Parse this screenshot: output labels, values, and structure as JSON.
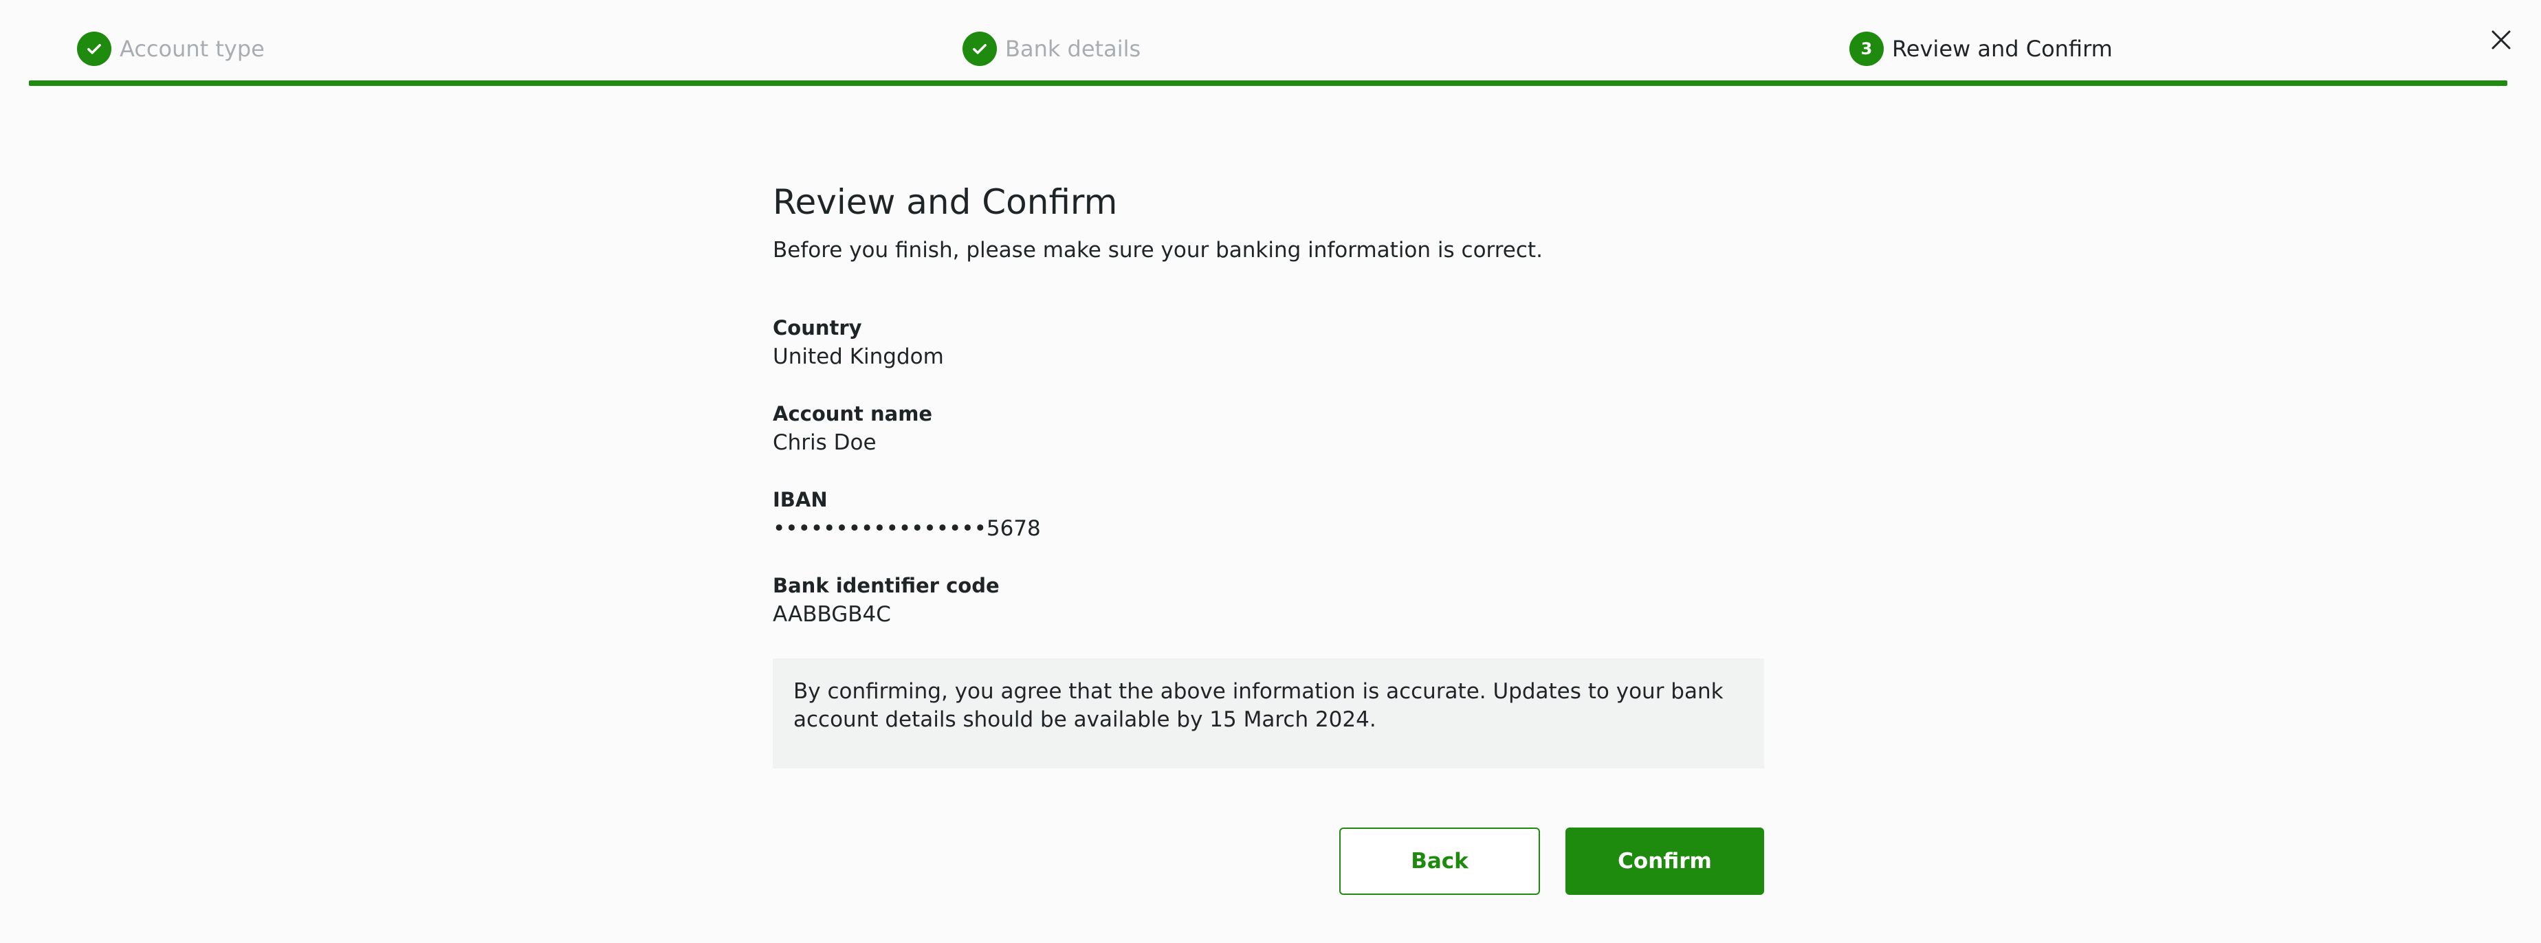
{
  "stepper": {
    "steps": [
      {
        "label": "Account type",
        "status": "done"
      },
      {
        "label": "Bank details",
        "status": "done"
      },
      {
        "label": "Review and Confirm",
        "status": "current",
        "number": "3"
      }
    ],
    "icon": "close-icon"
  },
  "main": {
    "title": "Review and Confirm",
    "subtitle": "Before you finish, please make sure your banking information is correct.",
    "fields": [
      {
        "label": "Country",
        "value": "United Kingdom"
      },
      {
        "label": "Account name",
        "value": "Chris Doe"
      },
      {
        "label": "IBAN",
        "value": "•••••••••••••••••5678"
      },
      {
        "label": "Bank identifier code",
        "value": "AABBGB4C"
      }
    ],
    "notice": "By confirming, you agree that the above information is accurate. Updates to your bank account details should be available by 15 March 2024."
  },
  "actions": {
    "back_label": "Back",
    "confirm_label": "Confirm"
  },
  "colors": {
    "accent": "#1e8a0e",
    "muted_text": "#a8adb1",
    "notice_bg": "#f1f3f3"
  }
}
